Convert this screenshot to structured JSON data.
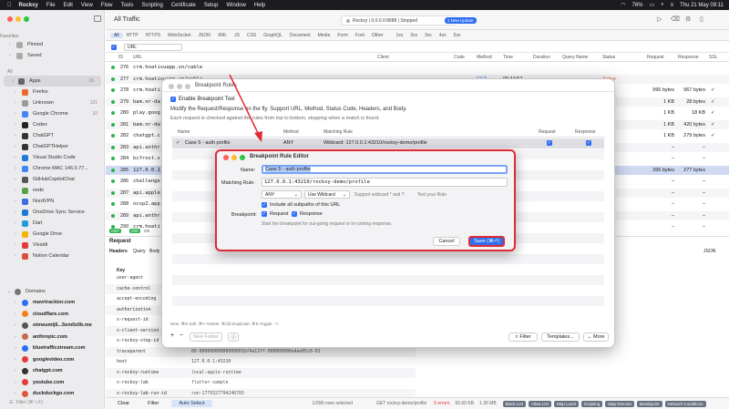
{
  "menubar": {
    "apple": "",
    "app": "Rockxy",
    "items": [
      "File",
      "Edit",
      "View",
      "Flow",
      "Tools",
      "Scripting",
      "Certificate",
      "Setup",
      "Window",
      "Help"
    ],
    "battery": "76%",
    "clock": "Thu 21 May 09:11"
  },
  "sidebar": {
    "favorites_label": "Favorites",
    "pinned": "Pinned",
    "saved": "Saved",
    "all_label": "All",
    "apps_label": "Apps",
    "apps_count": "16",
    "apps": [
      {
        "name": "Firefox",
        "count": "",
        "color": "#e8692c"
      },
      {
        "name": "Unknown",
        "count": "121",
        "color": "#9a9a9a"
      },
      {
        "name": "Google Chrome",
        "count": "10",
        "color": "#4285f4"
      },
      {
        "name": "Codex",
        "count": "",
        "color": "#222222"
      },
      {
        "name": "ChatGPT",
        "count": "",
        "color": "#333333"
      },
      {
        "name": "ChatGPTHelper",
        "count": "",
        "color": "#333333"
      },
      {
        "name": "Visual Studio Code",
        "count": "",
        "color": "#1f7ad6"
      },
      {
        "name": "Chrome MAC 146.0.77...",
        "count": "",
        "color": "#4285f4"
      },
      {
        "name": "GitHubCopilotChat",
        "count": "",
        "color": "#555555"
      },
      {
        "name": "node",
        "count": "",
        "color": "#5aa04b"
      },
      {
        "name": "NordVPN",
        "count": "",
        "color": "#3b6fe0"
      },
      {
        "name": "OneDrive Sync Service",
        "count": "",
        "color": "#1b7ad6"
      },
      {
        "name": "Dart",
        "count": "",
        "color": "#1e9cd7"
      },
      {
        "name": "Google Drive",
        "count": "",
        "color": "#f2b400"
      },
      {
        "name": "Vivaldi",
        "count": "",
        "color": "#e33b3b"
      },
      {
        "name": "Notion Calendar",
        "count": "",
        "color": "#d94f3a"
      }
    ],
    "domains_label": "Domains",
    "domains_count": "",
    "domains": [
      {
        "name": "mavrtracktor.com",
        "color": "#2f6ef3"
      },
      {
        "name": "cloudflare.com",
        "color": "#f48120"
      },
      {
        "name": "otmeumij6...5em0z0b.me",
        "color": "#555555"
      },
      {
        "name": "anthropic.com",
        "color": "#c26b4a"
      },
      {
        "name": "bluetrafficstream.com",
        "color": "#2f6ef3"
      },
      {
        "name": "googlevideo.com",
        "color": "#e33b3b"
      },
      {
        "name": "chatgpt.com",
        "color": "#333333"
      },
      {
        "name": "youtube.com",
        "color": "#e33b3b"
      },
      {
        "name": "duckduckgo.com",
        "color": "#de5833"
      }
    ],
    "filter_placeholder": "Filter (⌘⌥F)"
  },
  "titlebar": {
    "title": "All Traffic",
    "status": "Rockxy | 0.0.0.0:8888 | Stopped",
    "update_badge": "1 New Update"
  },
  "filters": [
    "All",
    "HTTP",
    "HTTPS",
    "WebSocket",
    "JSON",
    "XML",
    "JS",
    "CSS",
    "GraphQL",
    "Document",
    "Media",
    "Form",
    "Font",
    "Other",
    "1xx",
    "2xx",
    "3xx",
    "4xx",
    "5xx"
  ],
  "urlfilter": {
    "field": "URL",
    "placeholder": "Filter"
  },
  "table": {
    "headers": [
      "ID",
      "URL",
      "Client",
      "Code",
      "Method",
      "Time",
      "Duration",
      "Query Name",
      "Status",
      "Request",
      "Response",
      "SSL"
    ],
    "rows": [
      {
        "id": "276",
        "url": "crm.hoatisuapp.vn/cable",
        "code": "",
        "method": "",
        "time": "",
        "duration": "",
        "status": "",
        "req": "",
        "resp": "",
        "ssl": ""
      },
      {
        "id": "277",
        "url": "crm.hoatisuapp.vn/cable",
        "code": "",
        "method": "GET",
        "time": "09:44:52",
        "duration": "",
        "status": "Active",
        "req": "",
        "resp": "",
        "ssl": ""
      },
      {
        "id": "278",
        "url": "crm.hoati",
        "code": "",
        "method": "",
        "time": "",
        "duration": "",
        "status": "leted",
        "req": "995 bytes",
        "resp": "967 bytes",
        "ssl": "✓"
      },
      {
        "id": "279",
        "url": "bam.nr-da",
        "code": "",
        "method": "",
        "time": "",
        "duration": "",
        "status": "leted",
        "req": "1 KB",
        "resp": "28 bytes",
        "ssl": "✓"
      },
      {
        "id": "280",
        "url": "play.goog",
        "code": "",
        "method": "",
        "time": "",
        "duration": "",
        "status": "leted",
        "req": "1 KB",
        "resp": "18 KB",
        "ssl": "✓"
      },
      {
        "id": "281",
        "url": "bam.nr-da",
        "code": "",
        "method": "",
        "time": "",
        "duration": "",
        "status": "leted",
        "req": "1 KB",
        "resp": "420 bytes",
        "ssl": "✓"
      },
      {
        "id": "282",
        "url": "chatgpt.c",
        "code": "",
        "method": "",
        "time": "",
        "duration": "",
        "status": "leted",
        "req": "1 KB",
        "resp": "279 bytes",
        "ssl": "✓"
      },
      {
        "id": "283",
        "url": "api.anthr",
        "code": "",
        "method": "",
        "time": "",
        "duration": "",
        "status": "leted",
        "req": "–",
        "resp": "–",
        "ssl": ""
      },
      {
        "id": "284",
        "url": "bifrost.v",
        "code": "",
        "method": "",
        "time": "",
        "duration": "",
        "status": "leted",
        "req": "–",
        "resp": "–",
        "ssl": ""
      },
      {
        "id": "285",
        "url": "127.0.0.1",
        "code": "",
        "method": "",
        "time": "",
        "duration": "",
        "status": "leted",
        "req": "395 bytes",
        "resp": "277 bytes",
        "ssl": ""
      },
      {
        "id": "286",
        "url": "challenge",
        "code": "",
        "method": "",
        "time": "",
        "duration": "",
        "status": "leted",
        "req": "–",
        "resp": "–",
        "ssl": ""
      },
      {
        "id": "287",
        "url": "api.apple",
        "code": "",
        "method": "",
        "time": "",
        "duration": "",
        "status": "leted",
        "req": "–",
        "resp": "–",
        "ssl": ""
      },
      {
        "id": "288",
        "url": "ocsp2.app",
        "code": "",
        "method": "",
        "time": "",
        "duration": "",
        "status": "leted",
        "req": "–",
        "resp": "–",
        "ssl": ""
      },
      {
        "id": "289",
        "url": "api.anthr",
        "code": "",
        "method": "",
        "time": "",
        "duration": "",
        "status": "leted",
        "req": "–",
        "resp": "–",
        "ssl": ""
      },
      {
        "id": "290",
        "url": "crm.hoati",
        "code": "",
        "method": "",
        "time": "",
        "duration": "",
        "status": "leted",
        "req": "–",
        "resp": "–",
        "ssl": ""
      }
    ]
  },
  "detail": {
    "title": "Request",
    "status_badge": "GET",
    "status_badge2": "200",
    "status_badge3": "OK",
    "tabs": [
      "Headers",
      "Query",
      "Body"
    ],
    "key_header": "Key",
    "value_header": "Value",
    "rows": [
      {
        "k": "user-agent",
        "v": ""
      },
      {
        "k": "cache-control",
        "v": ""
      },
      {
        "k": "accept-encoding",
        "v": ""
      },
      {
        "k": "authorization",
        "v": ""
      },
      {
        "k": "x-request-id",
        "v": ""
      },
      {
        "k": "x-client-version",
        "v": ""
      },
      {
        "k": "x-rockxy-step-id",
        "v": ""
      },
      {
        "k": "traceparent",
        "v": "00-00000000000000001bf4a12ff-000000000a4ae05c6-01"
      },
      {
        "k": "host",
        "v": "127.0.0.1:43210"
      },
      {
        "k": "x-rockxy-runtime",
        "v": "local-apple-runtime"
      },
      {
        "k": "x-rockxy-lab",
        "v": "flutter-sample"
      },
      {
        "k": "x-rockxy-lab-run-id",
        "v": "run-1779327794246703"
      }
    ],
    "json_label": "JSON"
  },
  "bp_window": {
    "title": "Breakpoint Rules",
    "enable_label": "Enable Breakpoint Tool",
    "desc1": "Modify the Request/Response on the fly. Support URL, Method, Status Code, Headers, and Body.",
    "desc2": "Each request is checked against the rules from top to bottom, stopping when a match is found.",
    "headers": [
      "Name",
      "Method",
      "Matching Rule",
      "Request",
      "Response"
    ],
    "rule": {
      "name": "Case 5 - auth profile",
      "method": "ANY",
      "match": "Wildcard: 127.0.0.1:43210/rockxy-demo/profile"
    },
    "footer_hint": "New: ⌘N  Edit: ⌘↩  Delete: ⌘⌫  Duplicate: ⌘D  Toggle: ⌥",
    "add": "+",
    "remove": "−",
    "new_folder": "New Folder",
    "info": "ⓘ",
    "filter_btn": "Filter",
    "templates_btn": "Templates...",
    "more_btn": "More"
  },
  "editor": {
    "title": "Breakpoint Rule Editor",
    "name_label": "Name:",
    "name_value": "Case 5 - auth profile",
    "matching_label": "Matching Rule:",
    "matching_value": "127.0.0.1:43210/rockxy-demo/profile",
    "method_value": "ANY",
    "wildcard_value": "Use Wildcard",
    "wildcard_hint": "Support wildcard * and ?.",
    "test_link": "Test your Rule",
    "include_label": "Include all subpaths of this URL",
    "bp_label": "Breakpoint:",
    "request_label": "Request",
    "response_label": "Response",
    "bp_hint": "Start the breakpoint for out-going request or in-coming response.",
    "cancel": "Cancel",
    "save": "Save (⌘⏎)"
  },
  "bottombar": {
    "clear": "Clear",
    "filter": "Filter",
    "auto_select": "Auto Select",
    "rows_selected": "1/268 rows selected",
    "req_path": "GET rockxy-demo/profile",
    "errors": "5 errors",
    "upload": "50.60 KB",
    "download": "1.36 MB",
    "chips": [
      {
        "label": "Block List",
        "color": "#6a7282"
      },
      {
        "label": "Allow List",
        "color": "#6a7282"
      },
      {
        "label": "Map Local",
        "color": "#6a7282"
      },
      {
        "label": "Scripting",
        "color": "#6a7282"
      },
      {
        "label": "Map Remote",
        "color": "#6a7282"
      },
      {
        "label": "Breakpoint",
        "color": "#6a7282"
      },
      {
        "label": "Network Conditions",
        "color": "#6a7282"
      }
    ]
  }
}
